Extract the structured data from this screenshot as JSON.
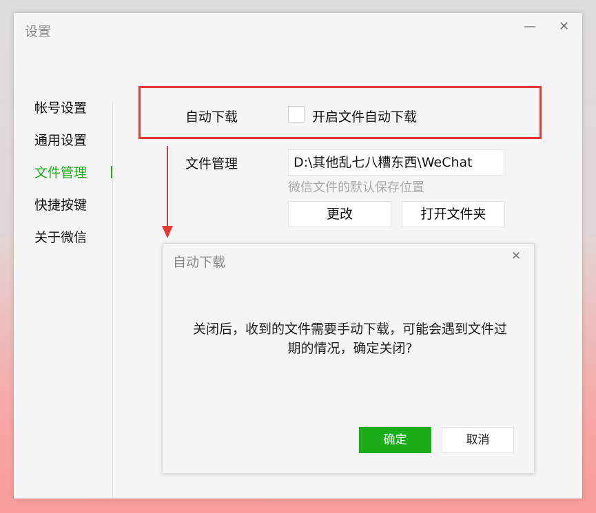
{
  "window": {
    "title": "设置",
    "minimize": "—",
    "close": "✕"
  },
  "sidebar": {
    "items": [
      {
        "label": "帐号设置"
      },
      {
        "label": "通用设置"
      },
      {
        "label": "文件管理",
        "active": true
      },
      {
        "label": "快捷按键"
      },
      {
        "label": "关于微信"
      }
    ]
  },
  "auto_download": {
    "label": "自动下载",
    "checkbox_label": "开启文件自动下载",
    "checked": false
  },
  "file_management": {
    "label": "文件管理",
    "path": "D:\\其他乱七八糟东西\\WeChat",
    "hint": "微信文件的默认保存位置",
    "change_button": "更改",
    "open_button": "打开文件夹"
  },
  "dialog": {
    "title": "自动下载",
    "close": "✕",
    "message": "关闭后，收到的文件需要手动下载，可能会遇到文件过期的情况，确定关闭?",
    "ok": "确定",
    "cancel": "取消"
  },
  "colors": {
    "accent": "#1aad19",
    "highlight": "#e53935"
  },
  "icons": {
    "arrow": "arrow-down-icon"
  }
}
